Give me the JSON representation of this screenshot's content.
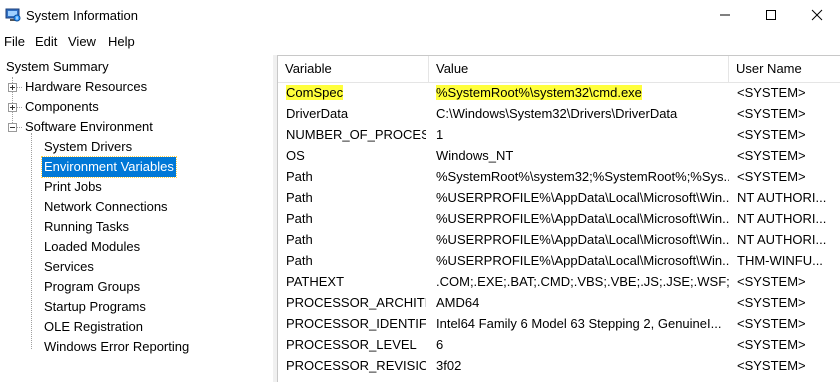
{
  "window": {
    "title": "System Information"
  },
  "menu": {
    "items": [
      {
        "label": "File"
      },
      {
        "label": "Edit"
      },
      {
        "label": "View"
      },
      {
        "label": "Help"
      }
    ]
  },
  "tree": {
    "root": "System Summary",
    "nodes": [
      {
        "label": "Hardware Resources",
        "expander": "+"
      },
      {
        "label": "Components",
        "expander": "+"
      },
      {
        "label": "Software Environment",
        "expander": "-"
      }
    ],
    "children": [
      {
        "label": "System Drivers"
      },
      {
        "label": "Environment Variables",
        "selected": true
      },
      {
        "label": "Print Jobs"
      },
      {
        "label": "Network Connections"
      },
      {
        "label": "Running Tasks"
      },
      {
        "label": "Loaded Modules"
      },
      {
        "label": "Services"
      },
      {
        "label": "Program Groups"
      },
      {
        "label": "Startup Programs"
      },
      {
        "label": "OLE Registration"
      },
      {
        "label": "Windows Error Reporting"
      }
    ]
  },
  "table": {
    "columns": [
      "Variable",
      "Value",
      "User Name"
    ],
    "rows": [
      [
        "ComSpec",
        "%SystemRoot%\\system32\\cmd.exe",
        "<SYSTEM>"
      ],
      [
        "DriverData",
        "C:\\Windows\\System32\\Drivers\\DriverData",
        "<SYSTEM>"
      ],
      [
        "NUMBER_OF_PROCESS...",
        "1",
        "<SYSTEM>"
      ],
      [
        "OS",
        "Windows_NT",
        "<SYSTEM>"
      ],
      [
        "Path",
        "%SystemRoot%\\system32;%SystemRoot%;%Sys...",
        "<SYSTEM>"
      ],
      [
        "Path",
        "%USERPROFILE%\\AppData\\Local\\Microsoft\\Win...",
        "NT AUTHORI..."
      ],
      [
        "Path",
        "%USERPROFILE%\\AppData\\Local\\Microsoft\\Win...",
        "NT AUTHORI..."
      ],
      [
        "Path",
        "%USERPROFILE%\\AppData\\Local\\Microsoft\\Win...",
        "NT AUTHORI..."
      ],
      [
        "Path",
        "%USERPROFILE%\\AppData\\Local\\Microsoft\\Win...",
        "THM-WINFU..."
      ],
      [
        "PATHEXT",
        ".COM;.EXE;.BAT;.CMD;.VBS;.VBE;.JS;.JSE;.WSF;.WS...",
        "<SYSTEM>"
      ],
      [
        "PROCESSOR_ARCHITE...",
        "AMD64",
        "<SYSTEM>"
      ],
      [
        "PROCESSOR_IDENTIFIER",
        "Intel64 Family 6 Model 63 Stepping 2, GenuineI...",
        "<SYSTEM>"
      ],
      [
        "PROCESSOR_LEVEL",
        "6",
        "<SYSTEM>"
      ],
      [
        "PROCESSOR_REVISION",
        "3f02",
        "<SYSTEM>"
      ]
    ]
  },
  "colors": {
    "selection": "#0078d7",
    "highlight": "#ffff3c"
  }
}
